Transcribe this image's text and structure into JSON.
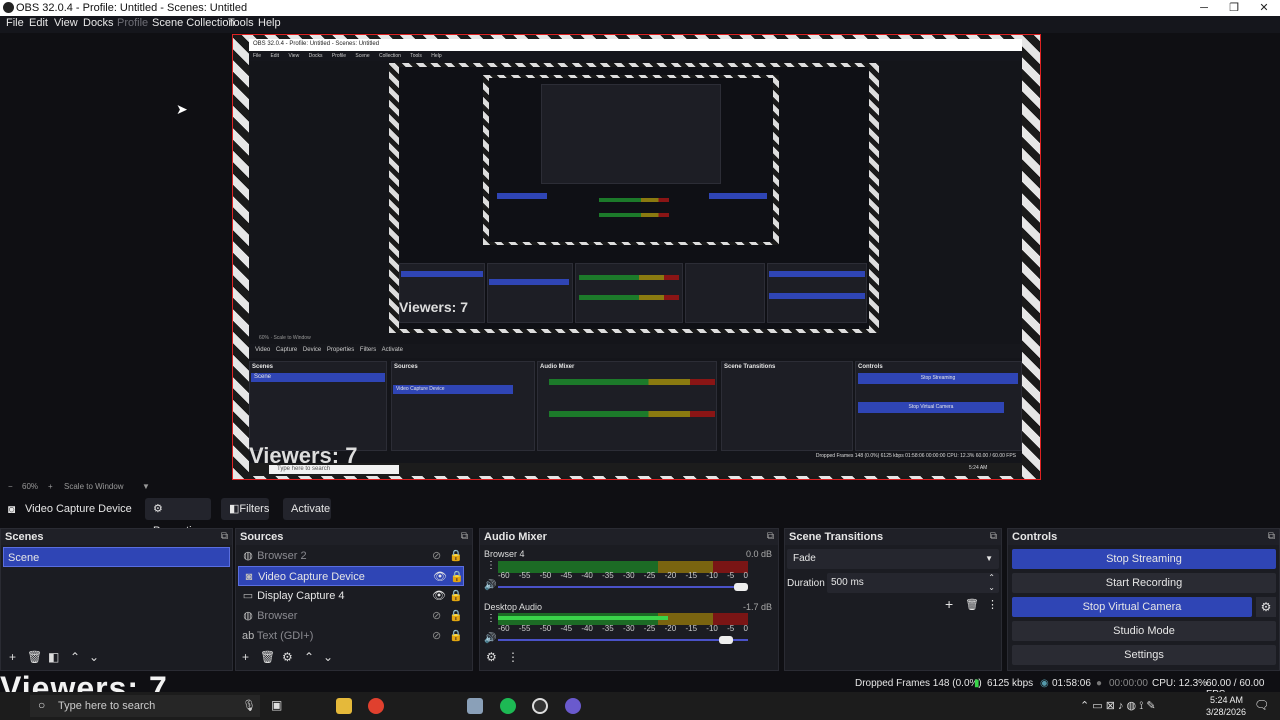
{
  "window": {
    "title": "OBS 32.0.4 - Profile: Untitled - Scenes: Untitled"
  },
  "menu": [
    "File",
    "Edit",
    "View",
    "Docks",
    "Profile",
    "Scene Collection",
    "Tools",
    "Help"
  ],
  "preview": {
    "mini_title": "OBS 32.0.4 - Profile: Untitled - Scenes: Untitled",
    "mini_viewers": "Viewers: 7",
    "mini_search": "Type here to search",
    "mini_status": "Dropped Frames 148 (0.0%)   6125 kbps   01:58:06   00:00:00   CPU: 12.3%   60.00 / 60.00 FPS",
    "mini_clock": "5:24 AM"
  },
  "scale": {
    "zoom": "60%",
    "mode": "Scale to Window"
  },
  "source_toolbar": {
    "source": "Video Capture Device",
    "properties": "Properties",
    "filters": "Filters",
    "activate": "Activate"
  },
  "scenes": {
    "title": "Scenes",
    "items": [
      "Scene"
    ]
  },
  "sources": {
    "title": "Sources",
    "items": [
      {
        "label": "Browser 2",
        "visible": false
      },
      {
        "label": "Video Capture Device",
        "visible": true
      },
      {
        "label": "Display Capture 4",
        "visible": true
      },
      {
        "label": "Browser",
        "visible": false
      },
      {
        "label": "Text (GDI+)",
        "visible": false
      }
    ]
  },
  "mixer": {
    "title": "Audio Mixer",
    "channels": [
      {
        "name": "Browser 4",
        "db": "0.0 dB",
        "level": 0.0,
        "volume": 1.0
      },
      {
        "name": "Desktop Audio",
        "db": "-1.7 dB",
        "level": 0.68,
        "volume": 0.94
      }
    ],
    "ticks": [
      "-60",
      "-55",
      "-50",
      "-45",
      "-40",
      "-35",
      "-30",
      "-25",
      "-20",
      "-15",
      "-10",
      "-5",
      "0"
    ]
  },
  "transitions": {
    "title": "Scene Transitions",
    "type": "Fade",
    "duration_label": "Duration",
    "duration": "500 ms"
  },
  "controls": {
    "title": "Controls",
    "stop_streaming": "Stop Streaming",
    "start_recording": "Start Recording",
    "stop_virtual_camera": "Stop Virtual Camera",
    "studio_mode": "Studio Mode",
    "settings": "Settings"
  },
  "status": {
    "dropped": "Dropped Frames 148 (0.0%)",
    "bitrate": "6125 kbps",
    "stream_time": "01:58:06",
    "rec_time": "00:00:00",
    "cpu": "CPU: 12.3%",
    "fps": "60.00 / 60.00 FPS"
  },
  "overlay": {
    "viewers": "Viewers: 7"
  },
  "taskbar": {
    "search": "Type here to search",
    "time": "5:24 AM",
    "date": "3/28/2026"
  },
  "colors": {
    "accent": "#2f45b5",
    "record_red": "#dd2222"
  }
}
